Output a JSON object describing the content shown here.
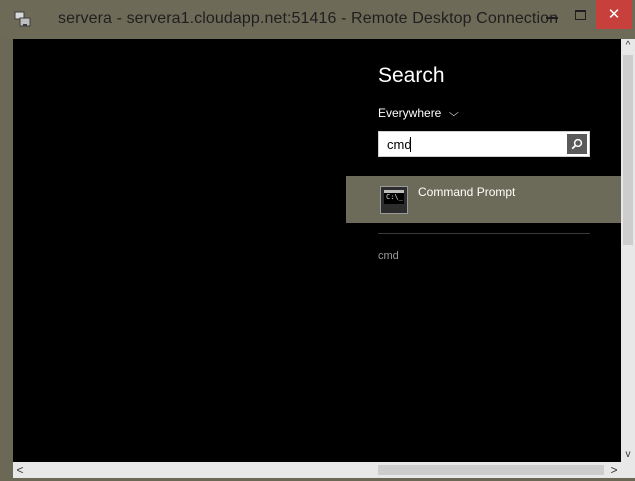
{
  "window": {
    "title": "servera - servera1.cloudapp.net:51416 - Remote Desktop Connection",
    "app_icon": "remote-desktop-icon",
    "controls": {
      "minimize": "minimize-icon",
      "maximize": "maximize-icon",
      "close": "✕"
    }
  },
  "colors": {
    "title_bar": "#6d6a58",
    "close_button": "#c8403b",
    "charm_accent": "#6c6a58",
    "desktop_bg": "#000000"
  },
  "search_charm": {
    "title": "Search",
    "scope_label": "Everywhere",
    "scope_chevron": "chevron-down-icon",
    "query_value": "cmd",
    "search_button_icon": "search-icon",
    "results": [
      {
        "label": "Command Prompt",
        "icon": "command-prompt-icon"
      }
    ],
    "suggestions": [
      "cmd"
    ]
  },
  "scrollbars": {
    "vertical": {
      "up": "^",
      "down": "v"
    },
    "horizontal": {
      "left": "<",
      "right": ">"
    }
  }
}
